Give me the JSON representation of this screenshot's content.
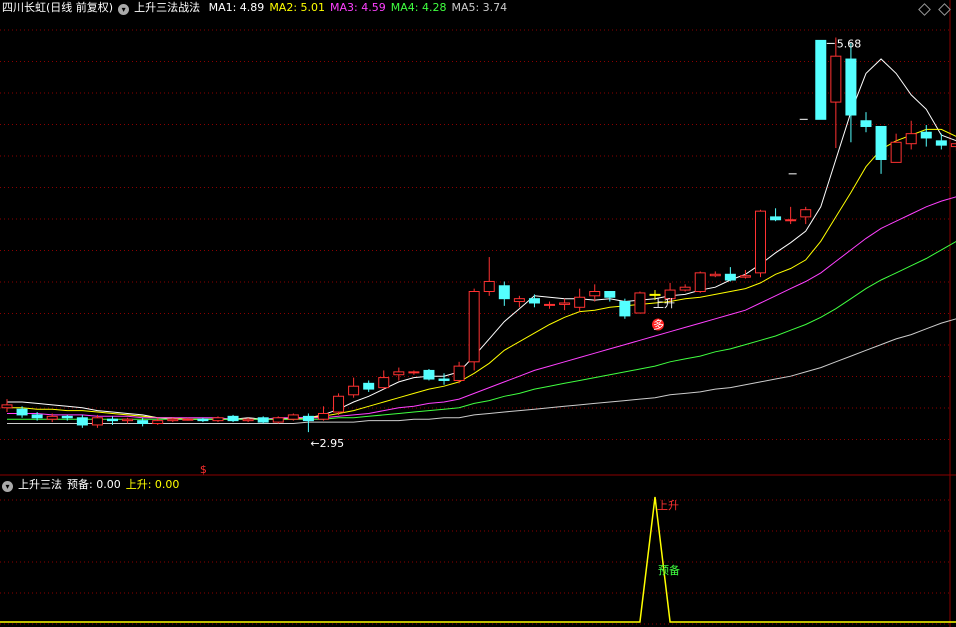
{
  "header": {
    "title": "四川长虹(日线 前复权)",
    "formula": "上升三法战法",
    "ma": [
      {
        "label": "MA1: 4.89",
        "color": "#ffffff"
      },
      {
        "label": "MA2: 5.01",
        "color": "#ffff00"
      },
      {
        "label": "MA3: 4.59",
        "color": "#ff40ff"
      },
      {
        "label": "MA4: 4.28",
        "color": "#40ff40"
      },
      {
        "label": "MA5: 3.74",
        "color": "#cccccc"
      }
    ]
  },
  "sub_header": {
    "title": "上升三法",
    "yubei_label": "预备: 0.00",
    "shangsheng_label": "上升: 0.00"
  },
  "annotations": {
    "high": "5.68",
    "low": "2.95",
    "shangsheng_main": "上升",
    "duo": "多",
    "dollar": "$",
    "sub_shangsheng": "上升",
    "sub_yubei": "预备"
  },
  "colors": {
    "up": "#ff3232",
    "down": "#54ffff",
    "signal": "#ffff00",
    "grid": "#8b0000"
  },
  "chart_data": {
    "type": "candlestick",
    "ylim": [
      2.7,
      5.85
    ],
    "candles": [
      [
        3.12,
        3.14,
        3.18,
        3.09
      ],
      [
        3.11,
        3.07,
        3.13,
        3.05
      ],
      [
        3.07,
        3.05,
        3.09,
        3.03
      ],
      [
        3.04,
        3.06,
        3.08,
        3.02
      ],
      [
        3.06,
        3.05,
        3.07,
        3.03
      ],
      [
        3.05,
        3.0,
        3.07,
        2.98
      ],
      [
        3.0,
        3.05,
        3.07,
        2.98
      ],
      [
        3.04,
        3.03,
        3.06,
        3.0
      ],
      [
        3.03,
        3.04,
        3.05,
        3.01
      ],
      [
        3.03,
        3.01,
        3.05,
        2.99
      ],
      [
        3.01,
        3.03,
        3.05,
        3.0
      ],
      [
        3.03,
        3.04,
        3.05,
        3.02
      ],
      [
        3.04,
        3.04,
        3.05,
        3.03
      ],
      [
        3.04,
        3.03,
        3.05,
        3.02
      ],
      [
        3.03,
        3.05,
        3.06,
        3.02
      ],
      [
        3.06,
        3.03,
        3.07,
        3.02
      ],
      [
        3.03,
        3.04,
        3.05,
        3.02
      ],
      [
        3.05,
        3.02,
        3.06,
        3.01
      ],
      [
        3.02,
        3.05,
        3.06,
        3.01
      ],
      [
        3.04,
        3.07,
        3.08,
        3.03
      ],
      [
        3.06,
        3.03,
        3.08,
        2.95
      ],
      [
        3.04,
        3.08,
        3.13,
        3.03
      ],
      [
        3.09,
        3.2,
        3.22,
        3.07
      ],
      [
        3.21,
        3.27,
        3.33,
        3.19
      ],
      [
        3.29,
        3.25,
        3.31,
        3.23
      ],
      [
        3.26,
        3.33,
        3.38,
        3.25
      ],
      [
        3.35,
        3.37,
        3.4,
        3.31
      ],
      [
        3.37,
        3.37,
        3.38,
        3.35
      ],
      [
        3.38,
        3.32,
        3.39,
        3.31
      ],
      [
        3.32,
        3.31,
        3.36,
        3.28
      ],
      [
        3.31,
        3.41,
        3.44,
        3.29
      ],
      [
        3.44,
        3.93,
        3.95,
        3.38
      ],
      [
        3.93,
        4.0,
        4.17,
        3.9
      ],
      [
        3.97,
        3.88,
        4.0,
        3.83
      ],
      [
        3.86,
        3.88,
        3.9,
        3.82
      ],
      [
        3.88,
        3.85,
        3.91,
        3.82
      ],
      [
        3.84,
        3.84,
        3.86,
        3.81
      ],
      [
        3.84,
        3.85,
        3.88,
        3.8
      ],
      [
        3.82,
        3.89,
        3.95,
        3.79
      ],
      [
        3.9,
        3.93,
        3.98,
        3.86
      ],
      [
        3.93,
        3.89,
        3.92,
        3.86
      ],
      [
        3.86,
        3.76,
        3.88,
        3.74
      ],
      [
        3.78,
        3.92,
        3.93,
        3.78
      ],
      [
        3.91,
        3.91,
        3.94,
        3.87
      ],
      [
        3.88,
        3.94,
        3.99,
        3.86
      ],
      [
        3.94,
        3.96,
        3.98,
        3.93
      ],
      [
        3.93,
        4.06,
        4.07,
        3.92
      ],
      [
        4.04,
        4.05,
        4.07,
        4.03
      ],
      [
        4.05,
        4.01,
        4.1,
        4.0
      ],
      [
        4.03,
        4.04,
        4.08,
        4.02
      ],
      [
        4.06,
        4.49,
        4.5,
        4.03
      ],
      [
        4.45,
        4.43,
        4.51,
        4.42
      ],
      [
        4.43,
        4.43,
        4.52,
        4.4
      ],
      [
        4.45,
        4.5,
        4.52,
        4.4
      ],
      [
        5.68,
        5.13,
        5.68,
        5.13
      ],
      [
        5.25,
        5.57,
        5.7,
        4.93
      ],
      [
        5.55,
        5.16,
        5.66,
        4.97
      ],
      [
        5.12,
        5.08,
        5.18,
        5.04
      ],
      [
        5.08,
        4.85,
        5.08,
        4.75
      ],
      [
        4.83,
        4.97,
        5.03,
        4.84
      ],
      [
        4.96,
        5.03,
        5.12,
        4.92
      ],
      [
        5.04,
        5.0,
        5.09,
        4.94
      ],
      [
        4.98,
        4.95,
        5.03,
        4.92
      ],
      [
        4.94,
        4.96,
        5.01,
        4.91
      ]
    ],
    "ma_series": [
      {
        "name": "MA1",
        "color": "#ffffff",
        "values": [
          3.16,
          3.16,
          3.15,
          3.14,
          3.13,
          3.12,
          3.1,
          3.09,
          3.08,
          3.07,
          3.05,
          3.04,
          3.04,
          3.04,
          3.04,
          3.04,
          3.05,
          3.04,
          3.04,
          3.05,
          3.05,
          3.07,
          3.11,
          3.16,
          3.2,
          3.25,
          3.3,
          3.33,
          3.34,
          3.34,
          3.37,
          3.48,
          3.6,
          3.72,
          3.81,
          3.9,
          3.89,
          3.88,
          3.88,
          3.87,
          3.88,
          3.86,
          3.87,
          3.88,
          3.9,
          3.91,
          3.94,
          3.96,
          4.01,
          4.05,
          4.12,
          4.2,
          4.27,
          4.35,
          4.52,
          4.85,
          5.18,
          5.45,
          5.55,
          5.45,
          5.3,
          5.2,
          5.02,
          4.98
        ]
      },
      {
        "name": "MA2",
        "color": "#ffff00",
        "values": [
          3.12,
          3.12,
          3.11,
          3.11,
          3.1,
          3.1,
          3.09,
          3.08,
          3.07,
          3.06,
          3.05,
          3.05,
          3.04,
          3.04,
          3.04,
          3.04,
          3.04,
          3.04,
          3.04,
          3.04,
          3.05,
          3.06,
          3.08,
          3.1,
          3.13,
          3.16,
          3.19,
          3.22,
          3.25,
          3.27,
          3.3,
          3.36,
          3.43,
          3.52,
          3.58,
          3.64,
          3.7,
          3.75,
          3.79,
          3.8,
          3.82,
          3.83,
          3.84,
          3.85,
          3.86,
          3.88,
          3.89,
          3.91,
          3.93,
          3.95,
          3.99,
          4.05,
          4.09,
          4.15,
          4.28,
          4.45,
          4.62,
          4.8,
          4.92,
          4.98,
          5.02,
          5.06,
          5.06,
          5.01
        ]
      },
      {
        "name": "MA3",
        "color": "#ff40ff",
        "values": [
          3.08,
          3.08,
          3.08,
          3.07,
          3.07,
          3.07,
          3.06,
          3.06,
          3.06,
          3.05,
          3.05,
          3.05,
          3.05,
          3.05,
          3.05,
          3.04,
          3.04,
          3.04,
          3.05,
          3.05,
          3.05,
          3.05,
          3.06,
          3.07,
          3.08,
          3.1,
          3.12,
          3.13,
          3.15,
          3.16,
          3.18,
          3.22,
          3.26,
          3.3,
          3.34,
          3.38,
          3.41,
          3.44,
          3.47,
          3.5,
          3.53,
          3.56,
          3.59,
          3.62,
          3.65,
          3.68,
          3.71,
          3.74,
          3.77,
          3.8,
          3.85,
          3.9,
          3.95,
          4.0,
          4.06,
          4.14,
          4.22,
          4.3,
          4.37,
          4.42,
          4.47,
          4.52,
          4.56,
          4.59
        ]
      },
      {
        "name": "MA4",
        "color": "#40ff40",
        "values": [
          3.04,
          3.04,
          3.04,
          3.04,
          3.04,
          3.04,
          3.04,
          3.04,
          3.04,
          3.04,
          3.04,
          3.04,
          3.04,
          3.04,
          3.04,
          3.04,
          3.04,
          3.04,
          3.04,
          3.04,
          3.04,
          3.04,
          3.05,
          3.05,
          3.06,
          3.07,
          3.08,
          3.09,
          3.1,
          3.11,
          3.12,
          3.15,
          3.17,
          3.2,
          3.22,
          3.25,
          3.27,
          3.29,
          3.31,
          3.33,
          3.35,
          3.37,
          3.39,
          3.41,
          3.44,
          3.46,
          3.48,
          3.51,
          3.53,
          3.56,
          3.59,
          3.62,
          3.66,
          3.7,
          3.75,
          3.81,
          3.88,
          3.95,
          4.01,
          4.06,
          4.11,
          4.16,
          4.22,
          4.28
        ]
      },
      {
        "name": "MA5",
        "color": "#cccccc",
        "values": [
          3.01,
          3.01,
          3.01,
          3.01,
          3.01,
          3.01,
          3.01,
          3.01,
          3.01,
          3.01,
          3.01,
          3.01,
          3.01,
          3.01,
          3.01,
          3.01,
          3.01,
          3.01,
          3.01,
          3.01,
          3.02,
          3.02,
          3.02,
          3.02,
          3.03,
          3.03,
          3.03,
          3.04,
          3.04,
          3.05,
          3.05,
          3.07,
          3.08,
          3.09,
          3.1,
          3.11,
          3.12,
          3.13,
          3.14,
          3.15,
          3.16,
          3.17,
          3.18,
          3.19,
          3.21,
          3.22,
          3.23,
          3.25,
          3.26,
          3.28,
          3.3,
          3.32,
          3.34,
          3.37,
          3.4,
          3.44,
          3.48,
          3.52,
          3.56,
          3.6,
          3.63,
          3.67,
          3.71,
          3.74
        ]
      }
    ],
    "signal_series": {
      "name": "上升",
      "values": [
        0,
        0,
        0,
        0,
        0,
        0,
        0,
        0,
        0,
        0,
        0,
        0,
        0,
        0,
        0,
        0,
        0,
        0,
        0,
        0,
        0,
        0,
        0,
        0,
        0,
        0,
        0,
        0,
        0,
        0,
        0,
        0,
        0,
        0,
        0,
        0,
        0,
        0,
        0,
        0,
        0,
        0,
        0,
        0,
        0,
        0,
        0,
        0,
        0,
        0,
        0,
        0,
        0,
        0,
        0,
        0,
        0,
        0,
        0,
        0,
        0,
        0,
        0,
        0
      ]
    },
    "signal_event": {
      "index": 43,
      "yubei": 0.5,
      "shangsheng": 1
    }
  }
}
